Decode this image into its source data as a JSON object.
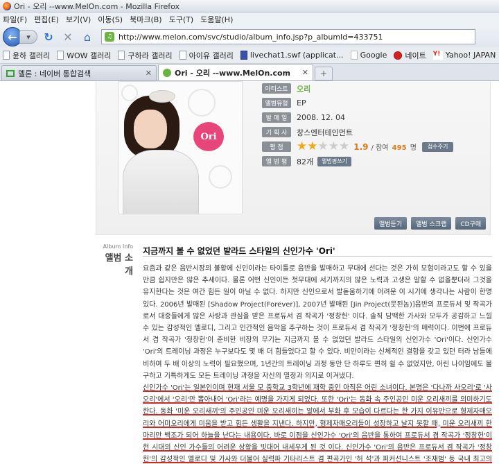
{
  "window": {
    "title": "Ori - 오리 --www.MelOn.com - Mozilla Firefox"
  },
  "menu": [
    "파일(F)",
    "편집(E)",
    "보기(V)",
    "이동(S)",
    "북마크(B)",
    "도구(T)",
    "도움말(H)"
  ],
  "address": {
    "url": "http://www.melon.com/svc/studio/album_info.jsp?p_albumId=433751"
  },
  "bookmarks": [
    {
      "label": "윤하 갤러리",
      "icon": "page-icon"
    },
    {
      "label": "WOW 갤러리",
      "icon": "page-icon"
    },
    {
      "label": "구하라 갤러리",
      "icon": "page-icon"
    },
    {
      "label": "아이유 갤러리",
      "icon": "page-icon"
    },
    {
      "label": "livechat1.swf (applicat...",
      "icon": "flash-icon"
    },
    {
      "label": "Google",
      "icon": "google-icon"
    },
    {
      "label": "네이트",
      "icon": "nate-icon"
    },
    {
      "label": "Yahoo! JAPAN",
      "icon": "yahoo-icon"
    }
  ],
  "tabs": [
    {
      "label": "멜론 : 네이버 통합검색",
      "active": false
    },
    {
      "label": "Ori - 오리 --www.MelOn.com",
      "active": true
    }
  ],
  "album": {
    "cover_logo": "Ori",
    "rows": [
      {
        "label": "아티스트",
        "value": "오리"
      },
      {
        "label": "앨범유형",
        "value": "EP"
      },
      {
        "label": "발 매 일",
        "value": "2008. 12. 04"
      },
      {
        "label": "기 획 사",
        "value": "창스엔터테인먼트"
      },
      {
        "label": "평 점"
      },
      {
        "label": "앨 범 평",
        "value": "82개"
      }
    ],
    "rating": {
      "score": "1.9",
      "stars_on": 2,
      "stars_total": 5,
      "prefix": "/ 참여",
      "count": "495",
      "suffix": "명",
      "button": "점수주기"
    },
    "review_button": "앨범평쓰기",
    "actions": [
      "앨범듣기",
      "앨범 스크랩",
      "CD구매"
    ]
  },
  "intro": {
    "heading_small": "Album Info",
    "heading": "앨범 소개",
    "title": "지금까지 볼 수 없었던 발라드 스타일의 신인가수 'Ori'",
    "paragraphs": [
      "요즘과 같은 음반시장의 불황에 신인이라는 타이틀로 음반을 발매하고 무대에 선다는 것은 가히 모험이라고도 할 수 있을 만큼 쉽지만은 않은 추세이다. 물론 어떤 신인이든 첫무대에 서기까지의 많은 노력과 고생은 말할 수 없을뿐더러 그것을 유지한다는 것은 여간 힘든 일이 아닐 수 없다. 하지만 신인으로서 발돋움하기에 어려운 이 시기에 생각나는 사람이 한명 있다. 2006년 발매된 [Shadow Project(Forever)], 2007년 발매된 [Jin Project(뭇된놈)]음반의 프로듀서 및 작곡가로서 대중들에게 많은 사랑과 관심을 받은 프로듀서 겸 작곡가 '정창헌' 이다. 솔직 담백한 가사와 모두가 공감하고 느낄 수 있는 감성적인 멜로디, 그리고 인간적인 음악을 추구하는 것이 프로듀서 겸 작곡가 '정창헌'의 매력이다. 이번에 프로듀서 겸 작곡가 '정창헌'이 준비한 비장의 무기는 지금까지 볼 수 없었던 발라드 스타일의 신인가수 'Ori'이다. 신인가수 'Ori'의 트레이닝 과정은 누구보다도 몇 배 더 힘들었다고 할 수 있다. 비만이라는 신체적인 결함을 갖고 있던 터라 남들에 비하여 두 배 이상의 노력이 필요했으며, 1년간의 트레이닝 과정 동안 단 하루도 편히 쉴 수 없었지만, 어린 나이임에도 불구하고 기특하게도 모든 트레이닝 과정을 자신의 열정과 의지로 이겨냈다.",
      "신인가수 'Ori'는 일본인이며 현재 서울 모 중학교 3학년에 재학 중인 아직은 어린 소녀이다. 본명은 '다나까 사오리'로 '사오리'에서 '오리'만 뽑아내어 'Ori'라는 예명을 가지게 되었다. 또한 'Ori'는 동화 속 주인공인 미운 오리새끼를 의미하기도 한다. 동화 '미운 오리새끼'의 주인공인 미운 오리새끼는 알에서 부화 후 모습이 다르다는 한 가지 이유만으로 형제자매오리와 어미오리에게 미움을 받고 힘든 생활을 지낸다. 하지만, 형제자매오리들이 성장하고 날지 못할 때, 미운 오리새끼 한 마리만 백조가 되어 하늘을 난다는 내용이다. 바로 이점을 신인가수 'Ori'의 음반을 통하여 프로듀서 겸 작곡가 '정창헌'이 현 시대의 신인 가수들의 어려운 상황을 빗대어 내세우게 된 것 이다. 신인가수 'Ori'의 음반은 프로듀서 겸 작곡가 '정창헌'의 감성적인 멜로디 및 가사와 더불어 실력파 기타리스트 겸 편곡가인 '허 석'과 퍼커션니스트 '조재범' 등 국내 최고의 뮤지션들과 함께 최상의 음반 제작을 진행하였으며, 신인가수 'Ori'의 이미지에 맞는 음악을 만들어냈다."
    ]
  },
  "colors": {
    "melon_green": "#6cb33f",
    "star_on": "#f0a818",
    "accent_orange": "#e07a16",
    "underline_red": "#dd2222"
  }
}
